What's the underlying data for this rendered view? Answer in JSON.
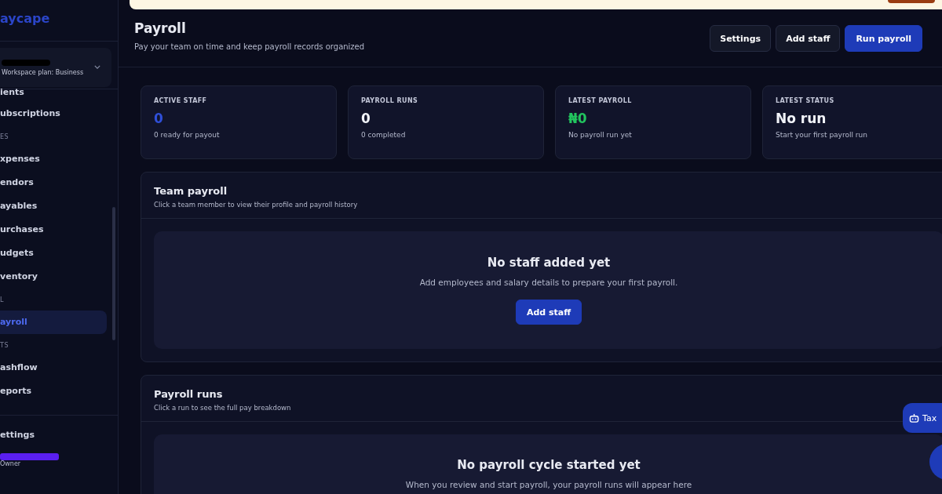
{
  "sidebar": {
    "logo": "aycape",
    "workspace": {
      "plan": "Workspace plan: Business"
    },
    "items": [
      {
        "kind": "item",
        "label": "ients",
        "selected": false
      },
      {
        "kind": "item",
        "label": "ubscriptions",
        "selected": false
      },
      {
        "kind": "section",
        "label": "ES"
      },
      {
        "kind": "item",
        "label": "xpenses",
        "selected": false
      },
      {
        "kind": "item",
        "label": "endors",
        "selected": false
      },
      {
        "kind": "item",
        "label": "ayables",
        "selected": false
      },
      {
        "kind": "item",
        "label": "urchases",
        "selected": false
      },
      {
        "kind": "item",
        "label": "udgets",
        "selected": false
      },
      {
        "kind": "item",
        "label": "ventory",
        "selected": false
      },
      {
        "kind": "section",
        "label": "L"
      },
      {
        "kind": "item",
        "label": "ayroll",
        "selected": true
      },
      {
        "kind": "section",
        "label": "TS"
      },
      {
        "kind": "item",
        "label": "ashflow",
        "selected": false
      },
      {
        "kind": "item",
        "label": "eports",
        "selected": false
      }
    ],
    "footer": {
      "settings": "ettings",
      "role": "Owner"
    }
  },
  "header": {
    "title": "Payroll",
    "subtitle": "Pay your team on time and keep payroll records organized",
    "buttons": [
      {
        "label": "Settings",
        "kind": "secondary"
      },
      {
        "label": "Add staff",
        "kind": "secondary"
      },
      {
        "label": "Run payroll",
        "kind": "primary"
      }
    ]
  },
  "stats": [
    {
      "label": "ACTIVE STAFF",
      "value": "0",
      "color": "#2f4fd8",
      "note": "0 ready for payout"
    },
    {
      "label": "PAYROLL RUNS",
      "value": "0",
      "color": "#f1f3f8",
      "note": "0 completed"
    },
    {
      "label": "LATEST PAYROLL",
      "value": "₦0",
      "color": "#22c55e",
      "note": "No payroll run yet"
    },
    {
      "label": "LATEST STATUS",
      "value": "No run",
      "color": "#f1f3f8",
      "note": "Start your first payroll run"
    }
  ],
  "sections": [
    {
      "title": "Team payroll",
      "subtitle": "Click a team member to view their profile and payroll history",
      "empty": {
        "title": "No staff added yet",
        "text": "Add employees and salary details to prepare your first payroll.",
        "button": "Add staff"
      }
    },
    {
      "title": "Payroll runs",
      "subtitle": "Click a run to see the full pay breakdown",
      "empty": {
        "title": "No payroll cycle started yet",
        "text": "When you review and start payroll, your payroll runs will appear here"
      }
    }
  ],
  "floating": {
    "label": "Tax"
  }
}
